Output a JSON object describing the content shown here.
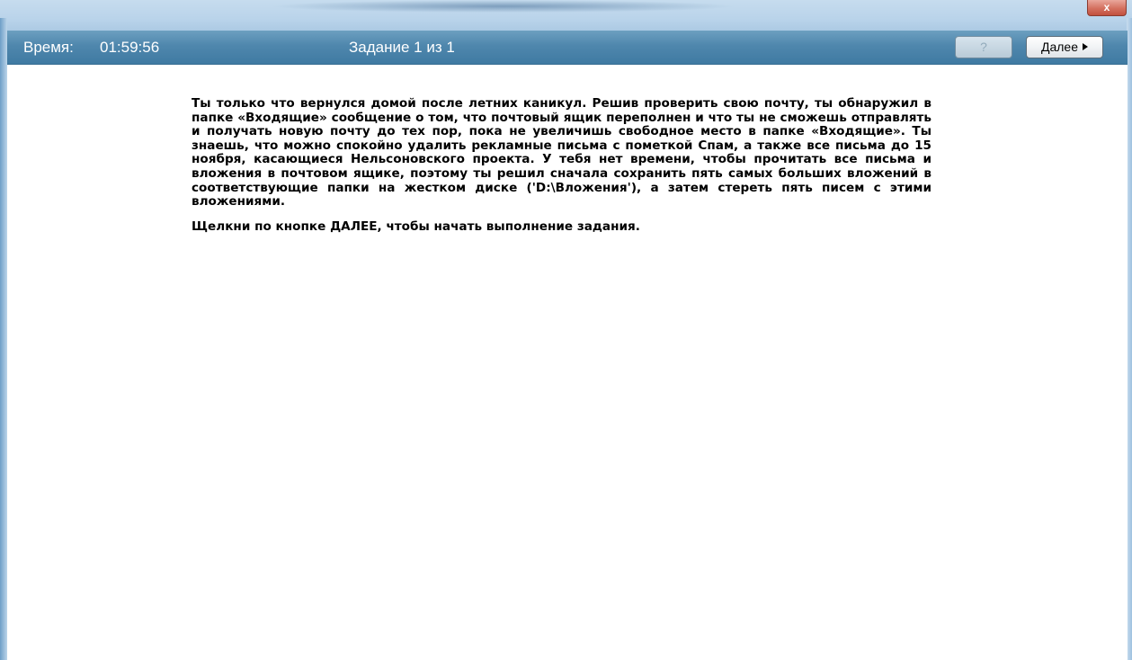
{
  "window": {
    "close_label": "x"
  },
  "header": {
    "timer_label": "Время:",
    "timer_value": "01:59:56",
    "task_counter": "Задание 1 из 1",
    "help_label": "?",
    "next_label": "Далее"
  },
  "content": {
    "description": "Ты только что вернулся домой после летних каникул. Решив проверить свою почту, ты обнаружил в папке «Входящие» сообщение о том, что почтовый ящик переполнен и что ты не сможешь отправлять и получать новую почту до тех пор, пока не увеличишь свободное место в папке «Входящие». Ты знаешь, что можно спокойно удалить рекламные письма с пометкой Спам, а также все письма до 15 ноября, касающиеся Нельсоновского проекта. У тебя нет времени, чтобы прочитать все письма и вложения в почтовом ящике, поэтому ты решил сначала сохранить пять самых больших вложений в соответствующие папки на жестком диске ('D:\\Вложения'), а затем стереть пять писем с этими вложениями.",
    "start_hint": "Щелкни по кнопке ДАЛЕЕ, чтобы начать выполнение задания."
  },
  "colors": {
    "header_bg": "#4f87ad",
    "header_text": "#ffffff",
    "close_button": "#d4705f",
    "content_bg": "#ffffff"
  },
  "icons": {
    "next": "triangle-right-icon"
  }
}
